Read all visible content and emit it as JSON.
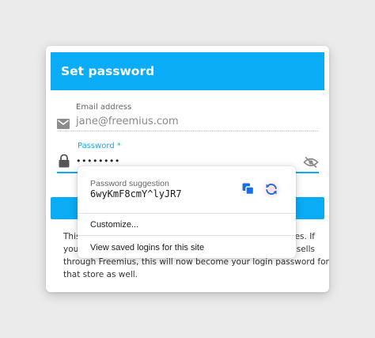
{
  "form": {
    "title": "Set password",
    "email_label": "Email address",
    "email_value": "jane@freemius.com",
    "password_label": "Password",
    "password_required_mark": "*",
    "password_value": "••••••••",
    "info_line1_start": "This",
    "info_line1_end": "es. If",
    "info_line2_start": "you'",
    "info_line2_end": "sells",
    "info_line3": "through Freemius, this will now become your login password for",
    "info_line4": "that store as well."
  },
  "password_popup": {
    "suggestion_label": "Password suggestion",
    "suggestion_value": "6wyKmF8cmY^lyJR7",
    "menu_items": [
      "Customize...",
      "View saved logins for this site"
    ]
  },
  "icons": {
    "email": "envelope-icon",
    "password": "lock-icon",
    "visibility": "eye-slash-icon",
    "copy": "copy-icon",
    "regenerate": "refresh-icon"
  },
  "colors": {
    "accent": "#0aacf6",
    "required": "#35c06b",
    "copy_icon": "#1a6fe0"
  }
}
